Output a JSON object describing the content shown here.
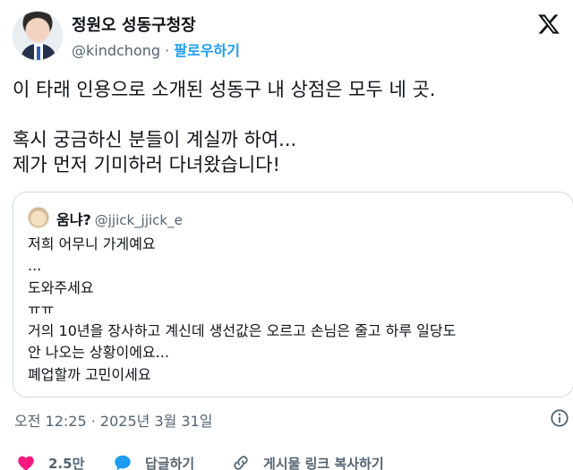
{
  "author": {
    "name": "정원오 성동구청장",
    "handle": "@kindchong",
    "separator": "·",
    "follow_label": "팔로우하기"
  },
  "tweet": {
    "lines": [
      "이 타래 인용으로 소개된 성동구 내 상점은 모두 네 곳.",
      "혹시 궁금하신 분들이 계실까 하여...",
      "제가 먼저 기미하러 다녀왔습니다!"
    ]
  },
  "quote": {
    "name": "움냐?",
    "handle": "@jjick_jjick_e",
    "lines": [
      "저희 어무니 가게예요",
      "...",
      "도와주세요",
      "ㅠㅠ",
      "거의 10년을 장사하고 계신데 생선값은 오르고 손님은 줄고 하루 일당도",
      "안 나오는 상황이에요...",
      "폐업할까 고민이세요"
    ]
  },
  "meta": {
    "time": "오전 12:25",
    "separator": "·",
    "date": "2025년 3월 31일"
  },
  "actions": {
    "like_count": "2.5만",
    "reply_label": "답글하기",
    "copy_label": "게시물 링크 복사하기"
  },
  "colors": {
    "accent": "#1d9bf0",
    "like": "#f91880",
    "text": "#0f1419",
    "secondary": "#536471",
    "border": "#cfd9de"
  },
  "icons": [
    "x-logo-icon",
    "info-icon",
    "heart-icon",
    "reply-bubble-icon",
    "link-icon"
  ]
}
